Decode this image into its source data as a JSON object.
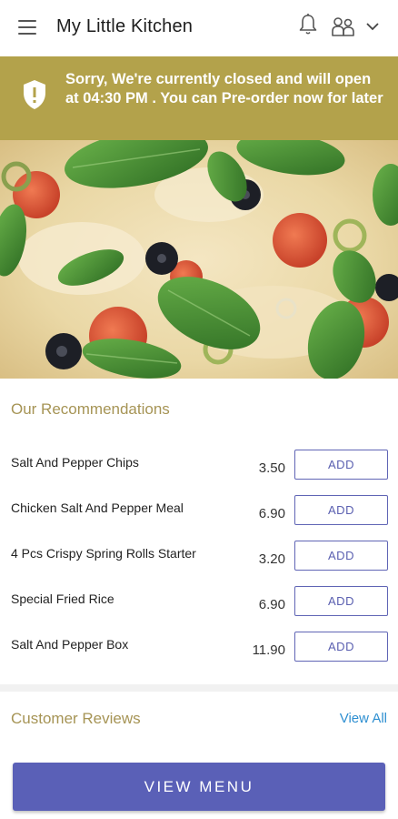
{
  "app": {
    "title": "My Little Kitchen"
  },
  "banner": {
    "message": "Sorry, We're currently closed and will open at 04:30 PM . You can Pre-order now for later",
    "color": "#b3a24b"
  },
  "hero": {
    "image": "pizza-image"
  },
  "recommendations": {
    "title": "Our Recommendations",
    "items": [
      {
        "name": "Salt And Pepper Chips",
        "price": "3.50",
        "action": "ADD"
      },
      {
        "name": "Chicken Salt And Pepper Meal",
        "price": "6.90",
        "action": "ADD"
      },
      {
        "name": "4 Pcs Crispy Spring Rolls Starter",
        "price": "3.20",
        "action": "ADD"
      },
      {
        "name": "Special Fried Rice",
        "price": "6.90",
        "action": "ADD"
      },
      {
        "name": "Salt And Pepper Box",
        "price": "11.90",
        "action": "ADD"
      }
    ]
  },
  "reviews": {
    "title": "Customer Reviews",
    "view_all": "View All"
  },
  "footer": {
    "view_menu": "VIEW MENU"
  },
  "colors": {
    "accent": "#5a60b7",
    "gold": "#a69455",
    "link": "#2e8fd1"
  }
}
